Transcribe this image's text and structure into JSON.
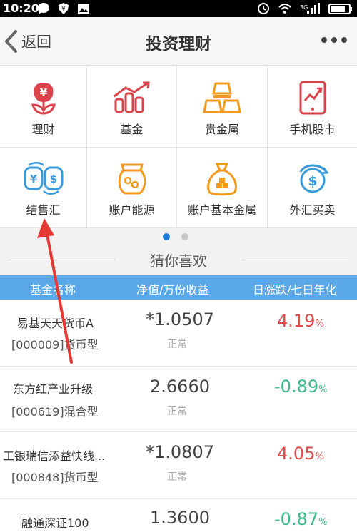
{
  "status_bar": {
    "time": "10:20"
  },
  "nav": {
    "back_label": "返回",
    "title": "投资理财"
  },
  "menu": {
    "items": [
      {
        "label": "理财",
        "icon": "flower-money-icon"
      },
      {
        "label": "基金",
        "icon": "bar-chart-icon"
      },
      {
        "label": "贵金属",
        "icon": "gold-bars-icon"
      },
      {
        "label": "手机股市",
        "icon": "tablet-chart-icon"
      },
      {
        "label": "结售汇",
        "icon": "currency-exchange-icon"
      },
      {
        "label": "账户能源",
        "icon": "energy-jar-icon"
      },
      {
        "label": "账户基本金属",
        "icon": "metal-bag-icon"
      },
      {
        "label": "外汇买卖",
        "icon": "dollar-cycle-icon"
      }
    ]
  },
  "pager": {
    "pages": 2,
    "active": 1
  },
  "recommend": {
    "title": "猜你喜欢",
    "columns": [
      "基金名称",
      "净值/万份收益",
      "日涨跌/七日年化"
    ],
    "rows": [
      {
        "name": "易基天天货币A",
        "code": "[000009]货币型",
        "nav": "*1.0507",
        "status": "正常",
        "change": "4.19",
        "pct": "%",
        "direction": "up"
      },
      {
        "name": "东方红产业升级",
        "code": "[000619]混合型",
        "nav": "2.6660",
        "status": "正常",
        "change": "-0.89",
        "pct": "%",
        "direction": "down"
      },
      {
        "name": "工银瑞信添益快线...",
        "code": "[000848]货币型",
        "nav": "*1.0807",
        "status": "正常",
        "change": "4.05",
        "pct": "%",
        "direction": "up"
      },
      {
        "name": "融通深证100",
        "code": "",
        "nav": "1.3600",
        "status": "",
        "change": "-0.87",
        "pct": "%",
        "direction": "down"
      }
    ]
  },
  "colors": {
    "accent": "#1f7fd6",
    "header_bg": "#5aa8e8",
    "up": "#e24a4a",
    "down": "#3fb98c",
    "icon_red": "#d9434c",
    "icon_orange": "#f29a1d",
    "icon_blue": "#3a9ad9"
  }
}
